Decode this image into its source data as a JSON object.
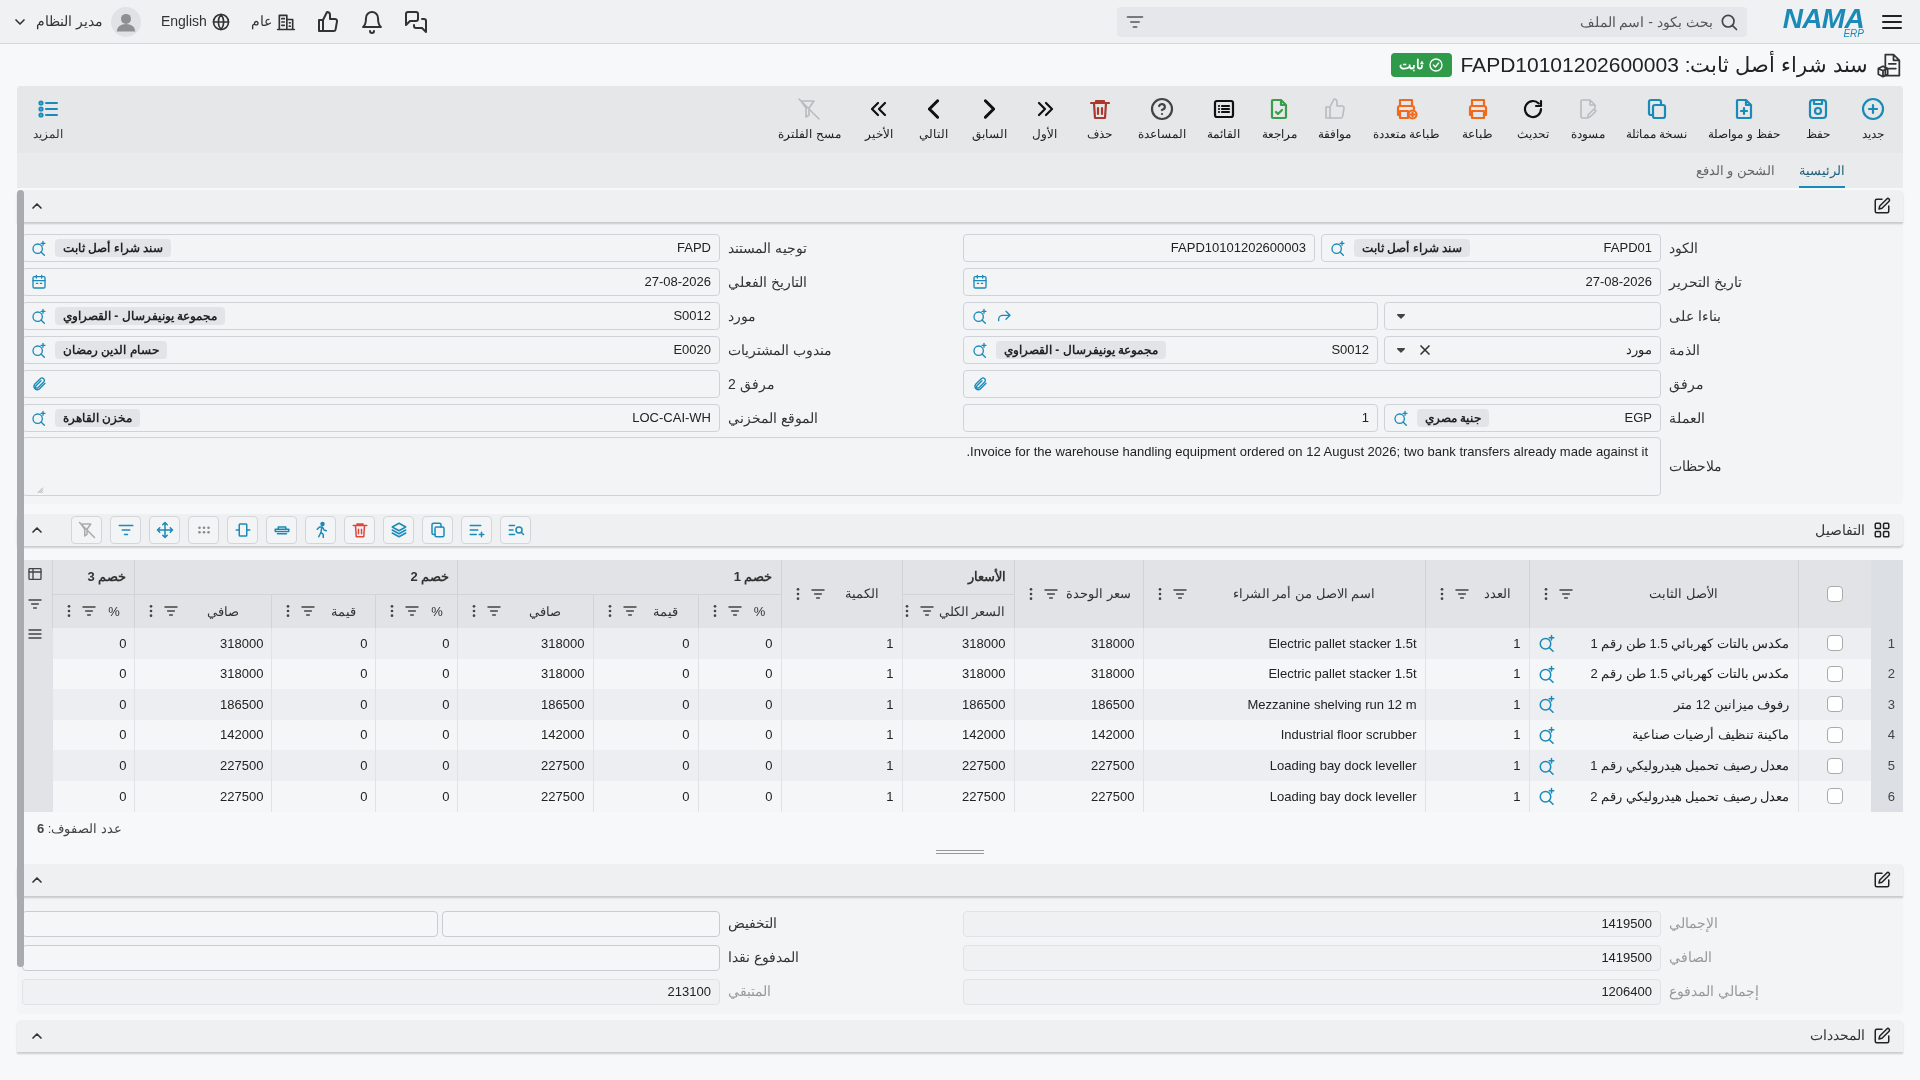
{
  "top_bar": {
    "logo": {
      "name": "NAMA",
      "suffix": "ERP"
    },
    "search": {
      "placeholder": "بحث بكود - اسم الملف"
    },
    "branch": "عام",
    "language": "English",
    "user": "مدير النظام"
  },
  "title": {
    "text": "سند شراء أصل ثابت: FAPD10101202600003",
    "status": "ثابت"
  },
  "toolbar": [
    {
      "kind": "new",
      "label": "جديد",
      "disabled": false
    },
    {
      "kind": "save",
      "label": "حفظ",
      "disabled": false
    },
    {
      "kind": "save_continue",
      "label": "حفظ و مواصلة",
      "disabled": false
    },
    {
      "kind": "duplicate",
      "label": "نسخة مماثلة",
      "disabled": false
    },
    {
      "kind": "draft",
      "label": "مسودة",
      "disabled": true
    },
    {
      "kind": "refresh",
      "label": "تحديث",
      "disabled": false
    },
    {
      "kind": "print",
      "label": "طباعة",
      "disabled": false
    },
    {
      "kind": "multi_print",
      "label": "طباعة متعددة",
      "disabled": false
    },
    {
      "kind": "approve",
      "label": "موافقة",
      "disabled": true
    },
    {
      "kind": "review",
      "label": "مراجعة",
      "disabled": false
    },
    {
      "kind": "list",
      "label": "القائمة",
      "disabled": false
    },
    {
      "kind": "help",
      "label": "المساعدة",
      "disabled": false
    },
    {
      "kind": "delete",
      "label": "حذف",
      "disabled": false
    },
    {
      "kind": "first",
      "label": "الأول",
      "disabled": false
    },
    {
      "kind": "previous",
      "label": "السابق",
      "disabled": false
    },
    {
      "kind": "next",
      "label": "التالي",
      "disabled": false
    },
    {
      "kind": "last",
      "label": "الأخير",
      "disabled": false
    },
    {
      "kind": "clear_filter",
      "label": "مسح الفلترة",
      "disabled": true
    }
  ],
  "more_button": "المزيد",
  "tabs": [
    {
      "label": "الرئيسية",
      "selected": true
    },
    {
      "label": "الشحن و الدفع",
      "selected": false
    }
  ],
  "header_form": {
    "right": [
      {
        "label": "الكود",
        "parts": [
          {
            "kind": "lookup",
            "value": "FAPD01",
            "name": "سند شراء أصل ثابت"
          },
          {
            "kind": "text",
            "value": "FAPD10101202600003"
          }
        ]
      },
      {
        "label": "تاريخ التحرير",
        "parts": [
          {
            "kind": "date",
            "value": "27-08-2026"
          }
        ]
      },
      {
        "label": "بناءا على",
        "parts": [
          {
            "kind": "select",
            "clearable": false
          },
          {
            "kind": "reference"
          }
        ]
      },
      {
        "label": "الذمة",
        "parts": [
          {
            "kind": "select",
            "value": "مورد",
            "clearable": true
          },
          {
            "kind": "lookup",
            "value": "S0012",
            "name": "مجموعة يونيفرسال - القصراوي"
          }
        ]
      },
      {
        "label": "مرفق",
        "parts": [
          {
            "kind": "attachment"
          }
        ]
      },
      {
        "label": "العملة",
        "parts": [
          {
            "kind": "lookup",
            "value": "EGP",
            "name": "جنية مصري"
          },
          {
            "kind": "text",
            "value": "1"
          }
        ]
      }
    ],
    "left": [
      {
        "label": "توجيه المستند",
        "parts": [
          {
            "kind": "lookup",
            "value": "FAPD",
            "name": "سند شراء أصل ثابت"
          }
        ]
      },
      {
        "label": "التاريخ الفعلي",
        "parts": [
          {
            "kind": "date",
            "value": "27-08-2026"
          }
        ]
      },
      {
        "label": "مورد",
        "parts": [
          {
            "kind": "lookup",
            "value": "S0012",
            "name": "مجموعة يونيفرسال - القصراوي"
          }
        ]
      },
      {
        "label": "مندوب المشتريات",
        "parts": [
          {
            "kind": "lookup",
            "value": "E0020",
            "name": "حسام الدين رمضان"
          }
        ]
      },
      {
        "label": "مرفق 2",
        "parts": [
          {
            "kind": "attachment"
          }
        ]
      },
      {
        "label": "الموقع المخزني",
        "parts": [
          {
            "kind": "lookup",
            "value": "LOC-CAI-WH",
            "name": "مخزن القاهرة"
          }
        ]
      }
    ],
    "notes": {
      "label": "ملاحظات",
      "value": "Invoice for the warehouse handling equipment ordered on 12 August 2026; two bank transfers already made against it."
    }
  },
  "details": {
    "title": "التفاصيل",
    "all_selected": false,
    "header": [
      {
        "label": "الأصل الثابت"
      },
      {
        "label": "العدد"
      },
      {
        "label": "اسم الاصل من أمر الشراء"
      },
      {
        "label": "سعر الوحدة"
      },
      {
        "group": "الأسعار",
        "columns": [
          "السعر الكلي"
        ]
      },
      {
        "label": "الكمية"
      },
      {
        "group": "خصم 1",
        "columns": [
          "%",
          "قيمة",
          "صافي"
        ]
      },
      {
        "group": "خصم 2",
        "columns": [
          "%",
          "قيمة",
          "صافي"
        ]
      },
      {
        "group": "خصم 3",
        "columns": [
          "%"
        ]
      }
    ],
    "rows": [
      {
        "number": "1",
        "selected": false,
        "cells": [
          "مكدس بالتات كهربائي 1.5 طن رقم 1",
          "1",
          "Electric pallet stacker 1.5t",
          "318000",
          "318000",
          "1",
          "0",
          "0",
          "318000",
          "0",
          "0",
          "318000",
          "0"
        ]
      },
      {
        "number": "2",
        "selected": false,
        "cells": [
          "مكدس بالتات كهربائي 1.5 طن رقم 2",
          "1",
          "Electric pallet stacker 1.5t",
          "318000",
          "318000",
          "1",
          "0",
          "0",
          "318000",
          "0",
          "0",
          "318000",
          "0"
        ]
      },
      {
        "number": "3",
        "selected": false,
        "cells": [
          "رفوف ميزانين 12 متر",
          "1",
          "Mezzanine shelving run 12 m",
          "186500",
          "186500",
          "1",
          "0",
          "0",
          "186500",
          "0",
          "0",
          "186500",
          "0"
        ]
      },
      {
        "number": "4",
        "selected": false,
        "cells": [
          "ماكينة تنظيف أرضيات صناعية",
          "1",
          "Industrial floor scrubber",
          "142000",
          "142000",
          "1",
          "0",
          "0",
          "142000",
          "0",
          "0",
          "142000",
          "0"
        ]
      },
      {
        "number": "5",
        "selected": false,
        "cells": [
          "معدل رصيف تحميل هيدروليكي رقم 1",
          "1",
          "Loading bay dock leveller",
          "227500",
          "227500",
          "1",
          "0",
          "0",
          "227500",
          "0",
          "0",
          "227500",
          "0"
        ]
      },
      {
        "number": "6",
        "selected": false,
        "cells": [
          "معدل رصيف تحميل هيدروليكي رقم 2",
          "1",
          "Loading bay dock leveller",
          "227500",
          "227500",
          "1",
          "0",
          "0",
          "227500",
          "0",
          "0",
          "227500",
          "0"
        ]
      }
    ],
    "row_count": "عدد الصفوف: **6**"
  },
  "summary": {
    "right": [
      {
        "label": "الإجمالي",
        "kind": "single",
        "value": "1419500",
        "disabled": true
      },
      {
        "label": "الصافي",
        "kind": "single",
        "value": "1419500",
        "disabled": true
      },
      {
        "label": "إجمالي المدفوع",
        "kind": "single",
        "value": "1206400",
        "disabled": true
      }
    ],
    "left": [
      {
        "label": "التخفيض",
        "kind": "pair",
        "disabled": false
      },
      {
        "label": "المدفوع نقدا",
        "kind": "single",
        "disabled": false
      },
      {
        "label": "المتبقي",
        "kind": "single",
        "value": "213100",
        "disabled": true
      }
    ]
  },
  "constraints": {
    "title": "المحددات"
  }
}
